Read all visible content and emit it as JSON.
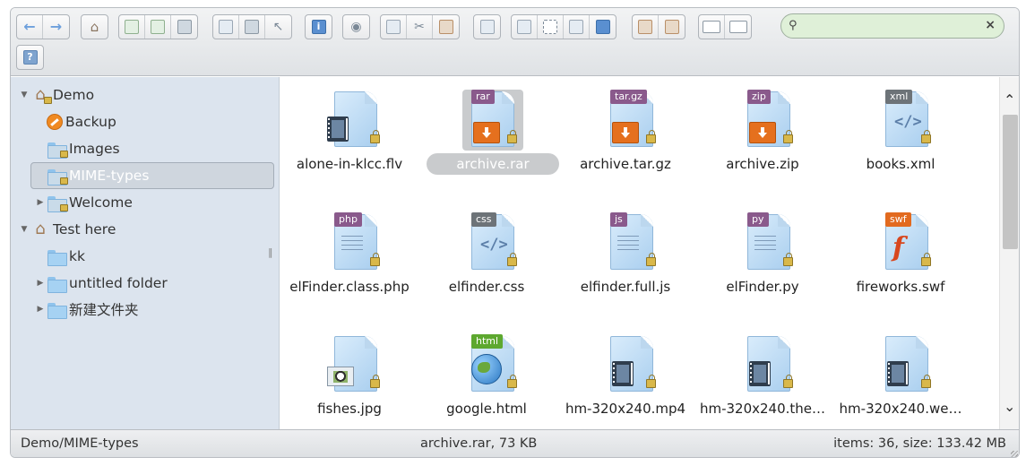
{
  "search": {
    "placeholder": "",
    "value": ""
  },
  "sidebar": {
    "items": [
      {
        "label": "Demo"
      },
      {
        "label": "Backup"
      },
      {
        "label": "Images"
      },
      {
        "label": "MIME-types"
      },
      {
        "label": "Welcome"
      },
      {
        "label": "Test here"
      },
      {
        "label": "kk"
      },
      {
        "label": "untitled folder"
      },
      {
        "label": "新建文件夹"
      }
    ]
  },
  "files": [
    {
      "name": "alone-in-klcc.flv",
      "tag": ""
    },
    {
      "name": "archive.rar",
      "tag": "rar"
    },
    {
      "name": "archive.tar.gz",
      "tag": "tar.gz"
    },
    {
      "name": "archive.zip",
      "tag": "zip"
    },
    {
      "name": "books.xml",
      "tag": "xml"
    },
    {
      "name": "elFinder.class.php",
      "tag": "php"
    },
    {
      "name": "elfinder.css",
      "tag": "css"
    },
    {
      "name": "elfinder.full.js",
      "tag": "js"
    },
    {
      "name": "elFinder.py",
      "tag": "py"
    },
    {
      "name": "fireworks.swf",
      "tag": "swf"
    },
    {
      "name": "fishes.jpg",
      "tag": ""
    },
    {
      "name": "google.html",
      "tag": "html"
    },
    {
      "name": "hm-320x240.mp4",
      "tag": ""
    },
    {
      "name": "hm-320x240.the…",
      "tag": ""
    },
    {
      "name": "hm-320x240.we…",
      "tag": ""
    }
  ],
  "status": {
    "path": "Demo/MIME-types",
    "selection": "archive.rar, 73 KB",
    "info": "items: 36, size: 133.42 MB"
  },
  "colors": {
    "accent": "#5a8fd0",
    "search_bg": "#dff0d8",
    "sidebar_bg": "#dce4ee"
  }
}
